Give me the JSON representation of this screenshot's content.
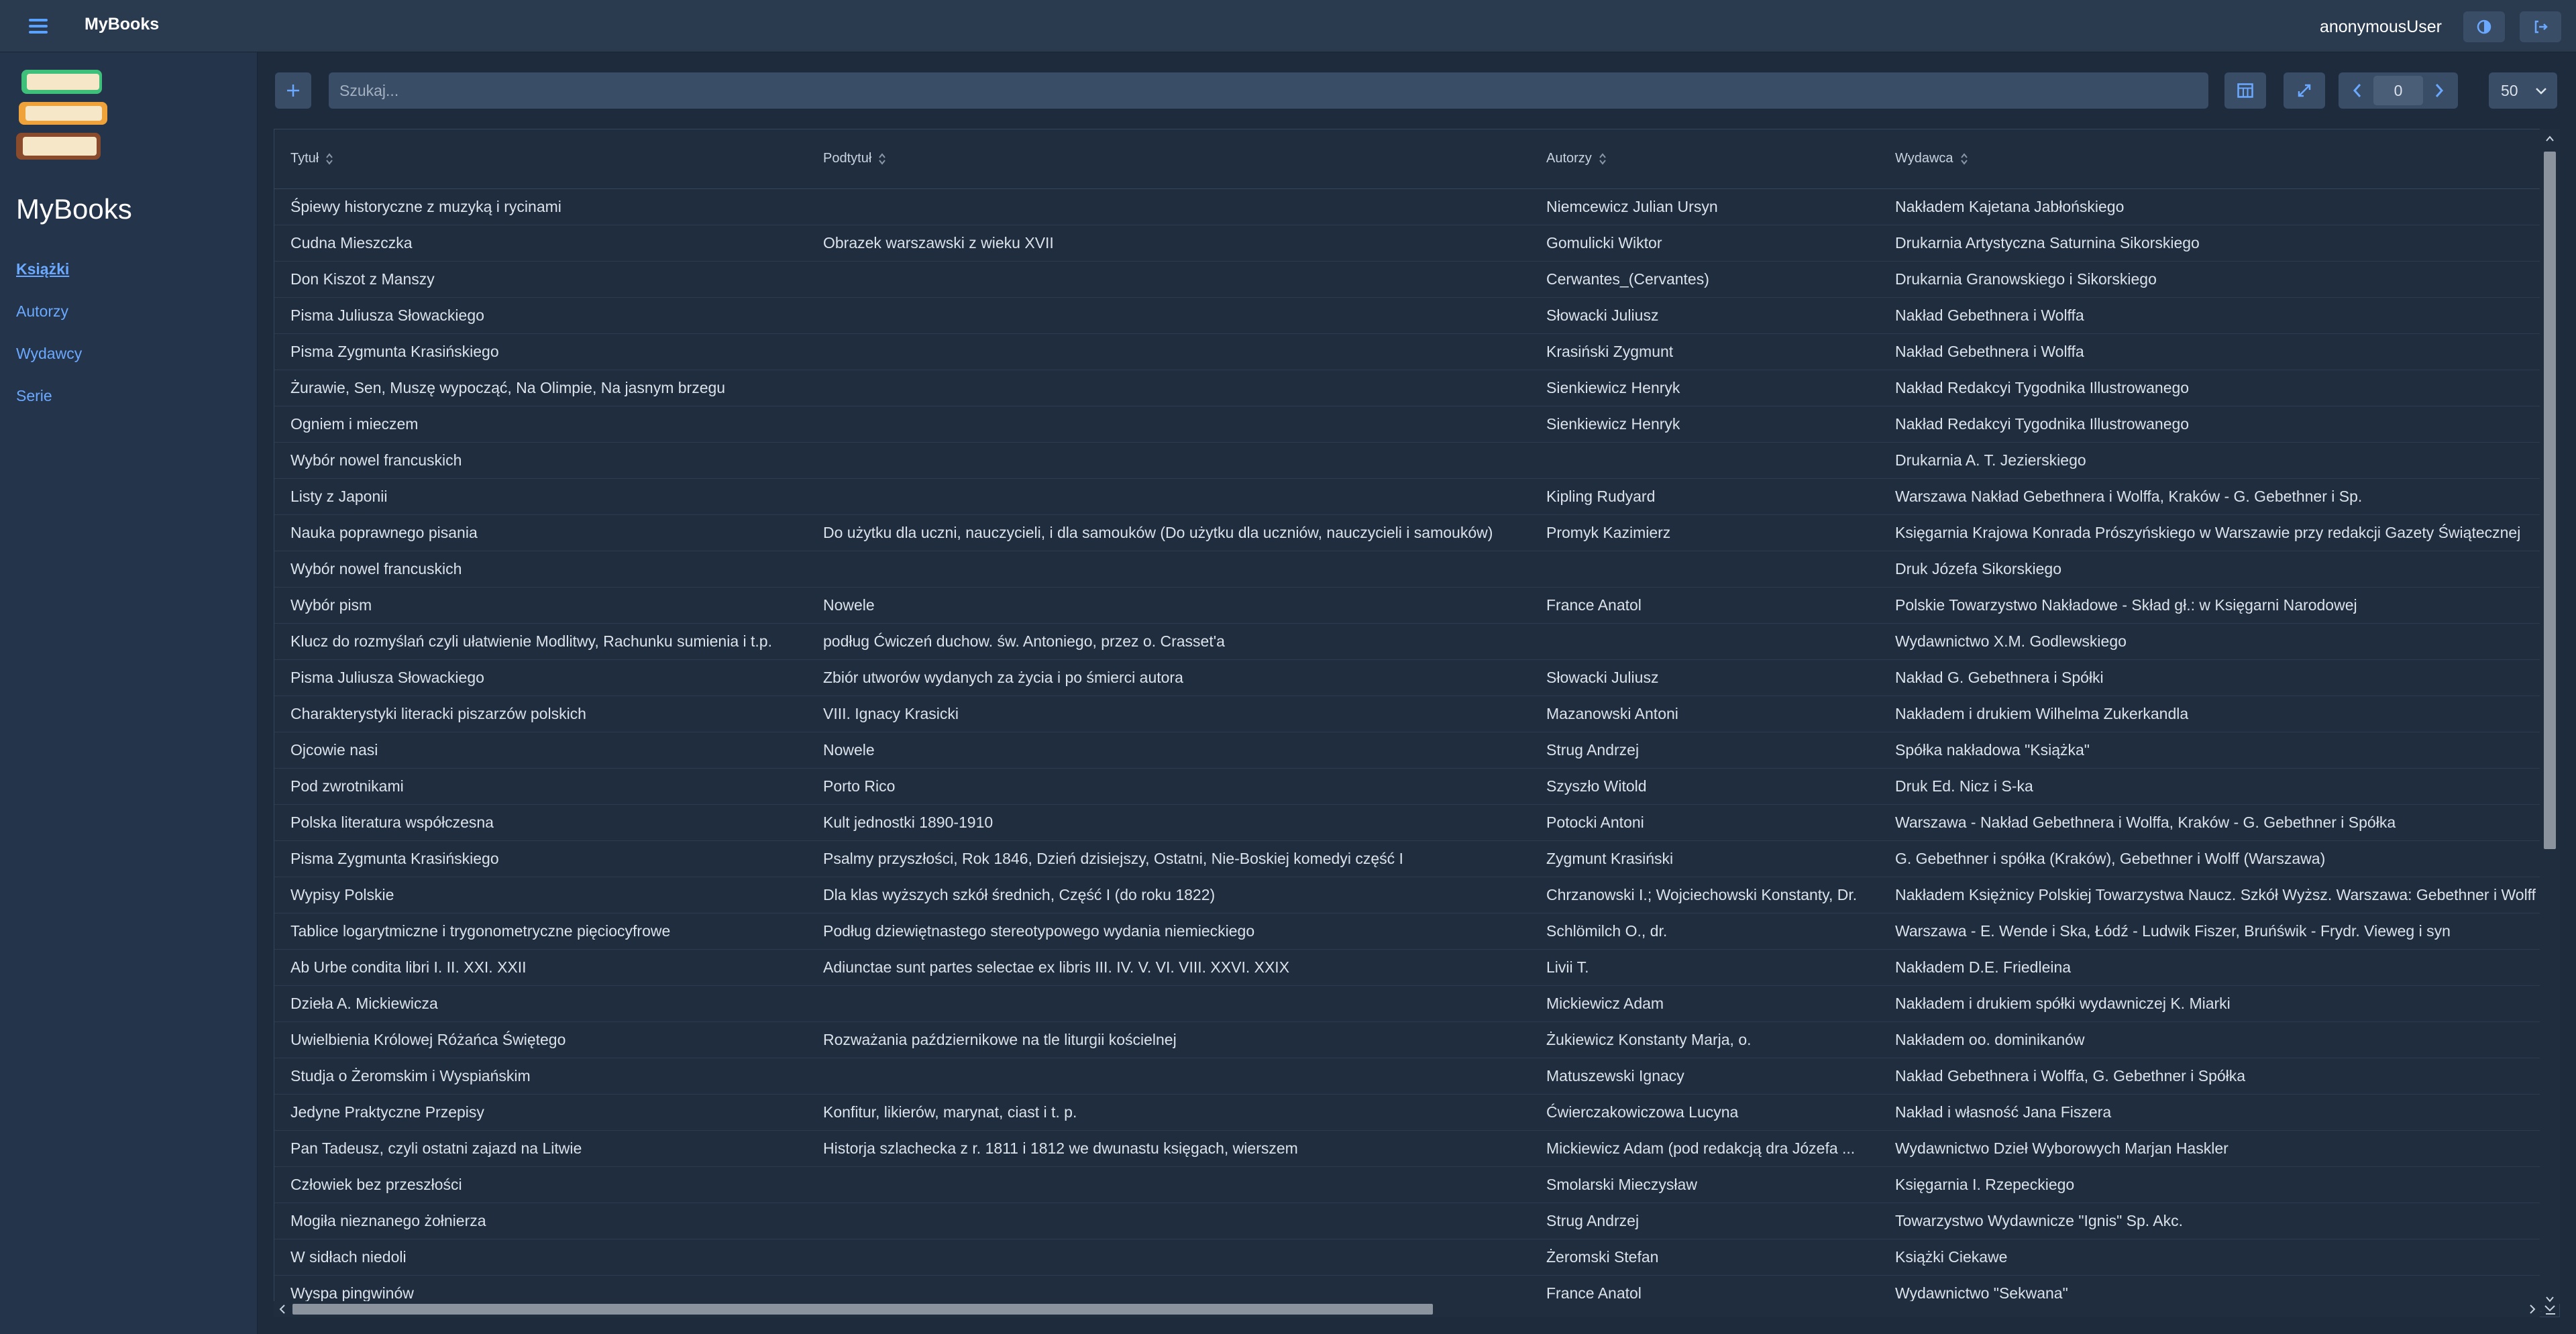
{
  "app": {
    "title": "MyBooks"
  },
  "header": {
    "user": "anonymousUser"
  },
  "sidebar": {
    "title": "MyBooks",
    "items": [
      {
        "label": "Książki",
        "active": true
      },
      {
        "label": "Autorzy",
        "active": false
      },
      {
        "label": "Wydawcy",
        "active": false
      },
      {
        "label": "Serie",
        "active": false
      }
    ]
  },
  "toolbar": {
    "add_icon": "plus-icon",
    "search_placeholder": "Szukaj...",
    "page": "0",
    "page_size": "50"
  },
  "table": {
    "columns": [
      "Tytuł",
      "Podtytuł",
      "Autorzy",
      "Wydawca"
    ],
    "rows": [
      [
        "Śpiewy historyczne z muzyką i rycinami",
        "",
        "Niemcewicz Julian Ursyn",
        "Nakładem Kajetana Jabłońskiego"
      ],
      [
        "Cudna Mieszczka",
        "Obrazek warszawski z wieku XVII",
        "Gomulicki Wiktor",
        "Drukarnia Artystyczna Saturnina Sikorskiego"
      ],
      [
        "Don Kiszot z Manszy",
        "",
        "Cerwantes_(Cervantes)",
        "Drukarnia Granowskiego i Sikorskiego"
      ],
      [
        "Pisma Juliusza Słowackiego",
        "",
        "Słowacki Juliusz",
        "Nakład Gebethnera i Wolffa"
      ],
      [
        "Pisma Zygmunta Krasińskiego",
        "",
        "Krasiński Zygmunt",
        "Nakład Gebethnera i Wolffa"
      ],
      [
        "Żurawie, Sen, Muszę wypocząć, Na Olimpie, Na jasnym brzegu",
        "",
        "Sienkiewicz Henryk",
        "Nakład Redakcyi Tygodnika Illustrowanego"
      ],
      [
        "Ogniem i mieczem",
        "",
        "Sienkiewicz Henryk",
        "Nakład Redakcyi Tygodnika Illustrowanego"
      ],
      [
        "Wybór nowel francuskich",
        "",
        "",
        "Drukarnia A. T. Jezierskiego"
      ],
      [
        "Listy z Japonii",
        "",
        "Kipling Rudyard",
        "Warszawa Nakład Gebethnera i Wolffa, Kraków - G. Gebethner i Sp."
      ],
      [
        "Nauka poprawnego pisania",
        "Do użytku dla uczni, nauczycieli, i dla samouków (Do użytku dla uczniów, nauczycieli i samouków)",
        "Promyk Kazimierz",
        "Księgarnia Krajowa Konrada Prószyńskiego w Warszawie przy redakcji Gazety Świątecznej"
      ],
      [
        "Wybór nowel francuskich",
        "",
        "",
        "Druk Józefa Sikorskiego"
      ],
      [
        "Wybór pism",
        "Nowele",
        "France Anatol",
        "Polskie Towarzystwo Nakładowe - Skład gł.: w Księgarni Narodowej"
      ],
      [
        "Klucz do rozmyślań czyli ułatwienie Modlitwy, Rachunku sumienia i t.p.",
        "podług Ćwiczeń duchow. św. Antoniego, przez o. Crasset'a",
        "",
        "Wydawnictwo X.M. Godlewskiego"
      ],
      [
        "Pisma Juliusza Słowackiego",
        "Zbiór utworów wydanych za życia i po śmierci autora",
        "Słowacki Juliusz",
        "Nakład G. Gebethnera i Spółki"
      ],
      [
        "Charakterystyki literacki piszarzów polskich",
        "VIII. Ignacy Krasicki",
        "Mazanowski Antoni",
        "Nakładem i drukiem Wilhelma Zukerkandla"
      ],
      [
        "Ojcowie nasi",
        "Nowele",
        "Strug Andrzej",
        "Spółka nakładowa \"Książka\""
      ],
      [
        "Pod zwrotnikami",
        "Porto Rico",
        "Szyszło Witold",
        "Druk Ed. Nicz i S-ka"
      ],
      [
        "Polska literatura współczesna",
        "Kult jednostki 1890-1910",
        "Potocki Antoni",
        "Warszawa - Nakład Gebethnera i Wolffa, Kraków - G. Gebethner i Spółka"
      ],
      [
        "Pisma Zygmunta Krasińskiego",
        "Psalmy przyszłości, Rok 1846, Dzień dzisiejszy, Ostatni, Nie-Boskiej komedyi część I",
        "Zygmunt Krasiński",
        "G. Gebethner i spółka (Kraków), Gebethner i Wolff (Warszawa)"
      ],
      [
        "Wypisy Polskie",
        "Dla klas wyższych szkół średnich, Część I (do roku 1822)",
        "Chrzanowski I.; Wojciechowski Konstanty, Dr.",
        "Nakładem Księżnicy Polskiej Towarzystwa Naucz. Szkół Wyższ. Warszawa: Gebethner i Wolff"
      ],
      [
        "Tablice logarytmiczne i trygonometryczne pięciocyfrowe",
        "Podług dziewiętnastego stereotypowego wydania niemieckiego",
        "Schlömilch O., dr.",
        "Warszawa - E. Wende i Ska, Łódź - Ludwik Fiszer, Bruńświk - Frydr. Vieweg i syn"
      ],
      [
        "Ab Urbe condita libri I. II. XXI. XXII",
        "Adiunctae sunt partes selectae ex libris III. IV. V. VI. VIII. XXVI. XXIX",
        "Livii T.",
        "Nakładem D.E. Friedleina"
      ],
      [
        "Dzieła A. Mickiewicza",
        "",
        "Mickiewicz Adam",
        "Nakładem i drukiem spółki wydawniczej K. Miarki"
      ],
      [
        "Uwielbienia Królowej Różańca Świętego",
        "Rozważania październikowe na tle liturgii kościelnej",
        "Żukiewicz Konstanty Marja, o.",
        "Nakładem oo. dominikanów"
      ],
      [
        "Studja o Żeromskim i Wyspiańskim",
        "",
        "Matuszewski Ignacy",
        "Nakład Gebethnera i Wolffa, G. Gebethner i Spółka"
      ],
      [
        "Jedyne Praktyczne Przepisy",
        "Konfitur, likierów, marynat, ciast i t. p.",
        "Ćwierczakowiczowa Lucyna",
        "Nakład i własność Jana Fiszera"
      ],
      [
        "Pan Tadeusz, czyli ostatni zajazd na Litwie",
        "Historja szlachecka z r. 1811 i 1812 we dwunastu księgach, wierszem",
        "Mickiewicz Adam (pod redakcją dra Józefa ...",
        "Wydawnictwo Dzieł Wyborowych Marjan Haskler"
      ],
      [
        "Człowiek bez przeszłości",
        "",
        "Smolarski Mieczysław",
        "Księgarnia I. Rzepeckiego"
      ],
      [
        "Mogiła nieznanego żołnierza",
        "",
        "Strug Andrzej",
        "Towarzystwo Wydawnicze \"Ignis\" Sp. Akc."
      ],
      [
        "W sidłach niedoli",
        "",
        "Żeromski Stefan",
        "Książki Ciekawe"
      ],
      [
        "Wyspa pingwinów",
        "",
        "France Anatol",
        "Wydawnictwo \"Sekwana\""
      ]
    ]
  },
  "colors": {
    "accent": "#6aa9ff",
    "background": "#1e2b3c",
    "topbar": "#2a3b50"
  }
}
